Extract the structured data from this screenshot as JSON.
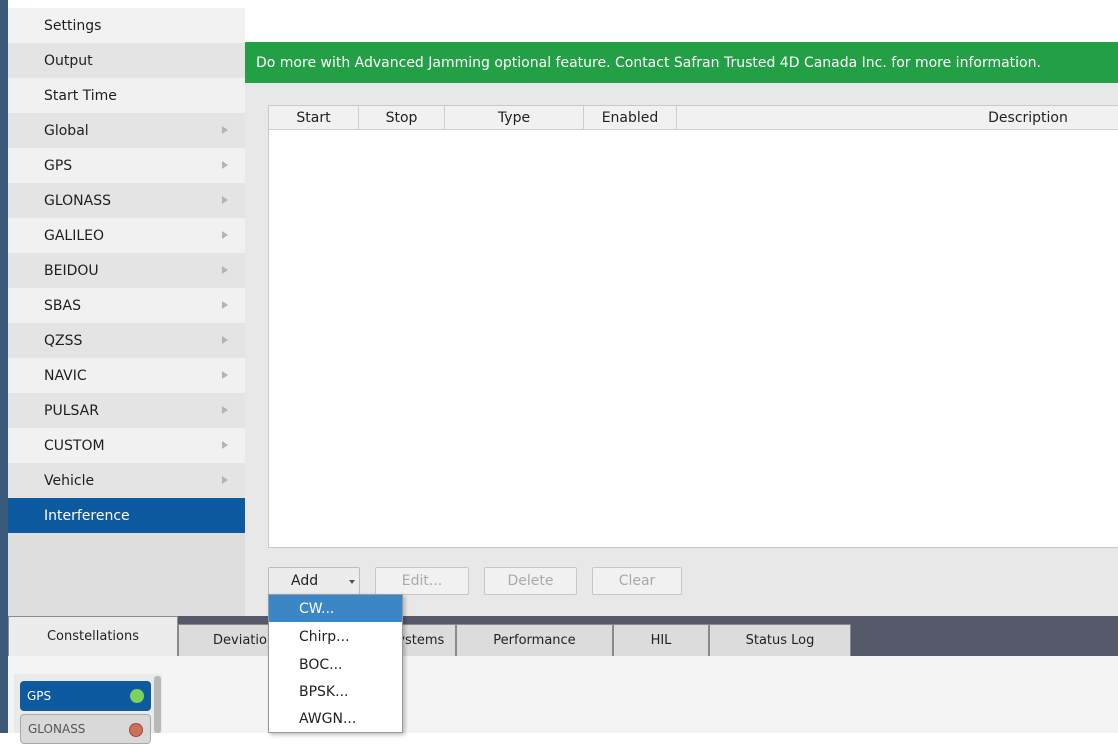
{
  "sidebar": {
    "items": [
      {
        "label": "Settings",
        "arrow": false
      },
      {
        "label": "Output",
        "arrow": false
      },
      {
        "label": "Start Time",
        "arrow": false
      },
      {
        "label": "Global",
        "arrow": true
      },
      {
        "label": "GPS",
        "arrow": true
      },
      {
        "label": "GLONASS",
        "arrow": true
      },
      {
        "label": "GALILEO",
        "arrow": true
      },
      {
        "label": "BEIDOU",
        "arrow": true
      },
      {
        "label": "SBAS",
        "arrow": true
      },
      {
        "label": "QZSS",
        "arrow": true
      },
      {
        "label": "NAVIC",
        "arrow": true
      },
      {
        "label": "PULSAR",
        "arrow": true
      },
      {
        "label": "CUSTOM",
        "arrow": true
      },
      {
        "label": "Vehicle",
        "arrow": true
      },
      {
        "label": "Interference",
        "arrow": false,
        "selected": true
      }
    ]
  },
  "banner": {
    "text": "Do more with Advanced Jamming optional feature. Contact Safran Trusted 4D Canada Inc. for more information."
  },
  "table": {
    "columns": [
      "Start",
      "Stop",
      "Type",
      "Enabled",
      "Description"
    ],
    "rows": []
  },
  "buttons": {
    "add": "Add",
    "edit": "Edit...",
    "delete": "Delete",
    "clear": "Clear"
  },
  "add_menu": {
    "items": [
      "CW...",
      "Chirp...",
      "BOC...",
      "BPSK...",
      "AWGN..."
    ],
    "highlighted": "CW..."
  },
  "bottom_tabs": [
    "Constellations",
    "Deviations",
    "Systems",
    "Performance",
    "HIL",
    "Status Log"
  ],
  "constellations": [
    {
      "name": "GPS",
      "status": "green"
    },
    {
      "name": "GLONASS",
      "status": "red"
    }
  ],
  "colors": {
    "accent": "#0d5aa0",
    "banner": "#23a046",
    "menu_highlight": "#3b87c6"
  }
}
